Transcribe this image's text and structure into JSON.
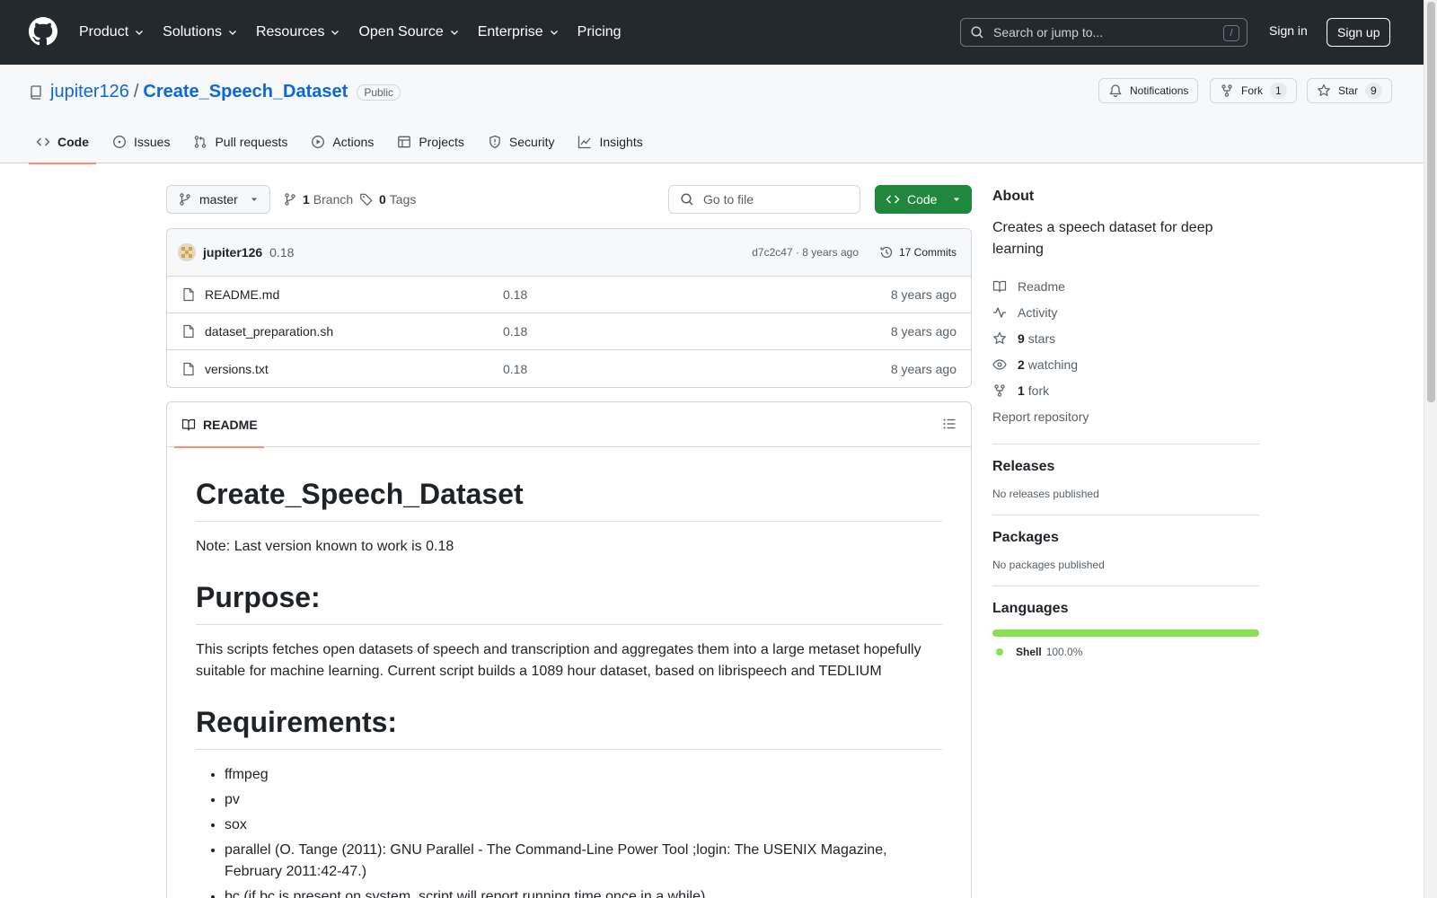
{
  "header": {
    "nav": [
      "Product",
      "Solutions",
      "Resources",
      "Open Source",
      "Enterprise",
      "Pricing"
    ],
    "search_placeholder": "Search or jump to...",
    "search_shortcut": "/",
    "signin": "Sign in",
    "signup": "Sign up"
  },
  "repo": {
    "owner": "jupiter126",
    "separator": "/",
    "name": "Create_Speech_Dataset",
    "visibility": "Public",
    "notifications": "Notifications",
    "fork_label": "Fork",
    "fork_count": "1",
    "star_label": "Star",
    "star_count": "9"
  },
  "tabs": [
    "Code",
    "Issues",
    "Pull requests",
    "Actions",
    "Projects",
    "Security",
    "Insights"
  ],
  "toolbar": {
    "branch": "master",
    "branch_count": "1",
    "branch_label": "Branch",
    "tag_count": "0",
    "tag_label": "Tags",
    "gofile_placeholder": "Go to file",
    "code_button": "Code"
  },
  "commit": {
    "author": "jupiter126",
    "message": "0.18",
    "sha_age": "d7c2c47 · 8 years ago",
    "commits": "17 Commits"
  },
  "files": [
    {
      "name": "README.md",
      "message": "0.18",
      "date": "8 years ago"
    },
    {
      "name": "dataset_preparation.sh",
      "message": "0.18",
      "date": "8 years ago"
    },
    {
      "name": "versions.txt",
      "message": "0.18",
      "date": "8 years ago"
    }
  ],
  "readme": {
    "tab": "README",
    "h1": "Create_Speech_Dataset",
    "note": "Note: Last version known to work is 0.18",
    "h_purpose": "Purpose:",
    "purpose": "This scripts fetches open datasets of speech and transcription and aggregates them into a large metaset hopefully suitable for machine learning. Current script builds a 1089 hour dataset, based on librispeech and TEDLIUM",
    "h_requirements": "Requirements:",
    "requirements": [
      "ffmpeg",
      "pv",
      "sox",
      "parallel (O. Tange (2011): GNU Parallel - The Command-Line Power Tool ;login: The USENIX Magazine, February 2011:42-47.)",
      "bc (if bc is present on system, script will report running time once in a while)"
    ]
  },
  "about": {
    "title": "About",
    "description": "Creates a speech dataset for deep learning",
    "readme": "Readme",
    "activity": "Activity",
    "stars_count": "9",
    "stars_label": "stars",
    "watching_count": "2",
    "watching_label": "watching",
    "forks_count": "1",
    "forks_label": "fork",
    "report": "Report repository"
  },
  "releases": {
    "title": "Releases",
    "empty": "No releases published"
  },
  "packages": {
    "title": "Packages",
    "empty": "No packages published"
  },
  "languages": {
    "title": "Languages",
    "name": "Shell",
    "percent": "100.0%",
    "color": "#89e051"
  },
  "colors": {
    "header_bg": "#24292f",
    "link": "#0969da",
    "primary_button": "#1f883d",
    "tab_underline": "#fd8c73"
  }
}
